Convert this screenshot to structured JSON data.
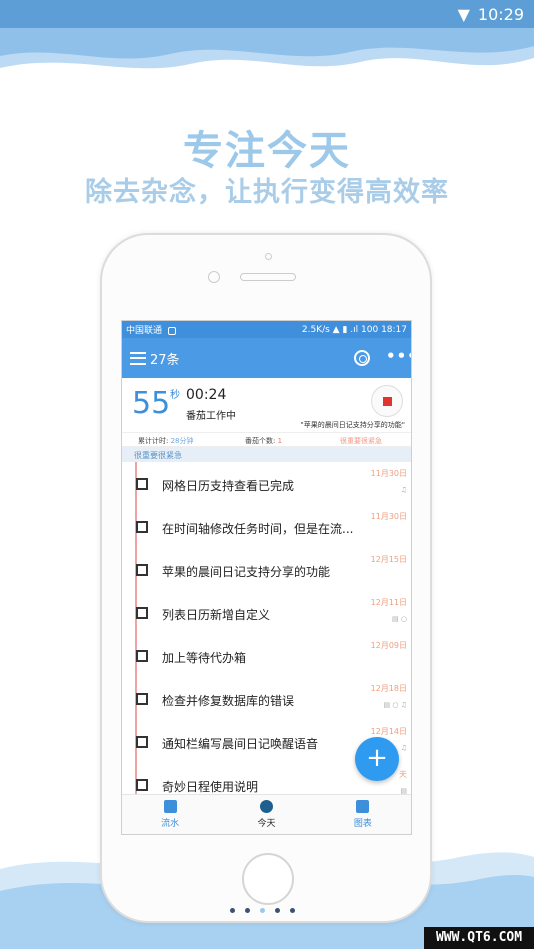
{
  "device_status": {
    "time": "10:29"
  },
  "promo": {
    "headline": "专注今天",
    "subline": "除去杂念，让执行变得高效率"
  },
  "app": {
    "status_bar": {
      "carrier": "中国联通",
      "speed": "2.5K/s",
      "battery": "100",
      "time": "18:17"
    },
    "toolbar": {
      "task_count": "27条",
      "more_label": "•••"
    },
    "pomodoro": {
      "seconds": "55",
      "seconds_unit": "秒",
      "clock": "00:24",
      "status": "番茄工作中",
      "current_task": "\"苹果的晨间日记支持分享的功能\"",
      "stats": {
        "total_label": "累计计时:",
        "total_value": "28分钟",
        "count_label": "番茄个数:",
        "count_value": "1",
        "priority": "很重要很紧急"
      }
    },
    "group_header": "很重要很紧急",
    "tasks": [
      {
        "title": "网格日历支持查看已完成",
        "date": "11月30日",
        "meta": "♫"
      },
      {
        "title": "在时间轴修改任务时间，但是在流...",
        "date": "11月30日",
        "meta": ""
      },
      {
        "title": "苹果的晨间日记支持分享的功能",
        "date": "12月15日",
        "meta": ""
      },
      {
        "title": "列表日历新增自定义",
        "date": "12月11日",
        "meta": "▤ ○"
      },
      {
        "title": "加上等待代办箱",
        "date": "12月09日",
        "meta": ""
      },
      {
        "title": "检查并修复数据库的错误",
        "date": "12月18日",
        "meta": "▤ ○ ♫"
      },
      {
        "title": "通知栏编写晨间日记唤醒语音",
        "date": "12月14日",
        "meta": "♫"
      },
      {
        "title": "奇妙日程使用说明",
        "date": "天",
        "meta": "▤"
      }
    ],
    "fab_label": "+",
    "bottom_nav": [
      {
        "label": "流水",
        "icon": "list-icon"
      },
      {
        "label": "今天",
        "icon": "star-icon"
      },
      {
        "label": "图表",
        "icon": "chart-icon"
      }
    ]
  },
  "watermark": "WWW.QT6.COM",
  "colors": {
    "primary": "#4a9ae6",
    "accent": "#2e9bf0",
    "headline": "#9cc8ea",
    "date": "#f0a080"
  }
}
